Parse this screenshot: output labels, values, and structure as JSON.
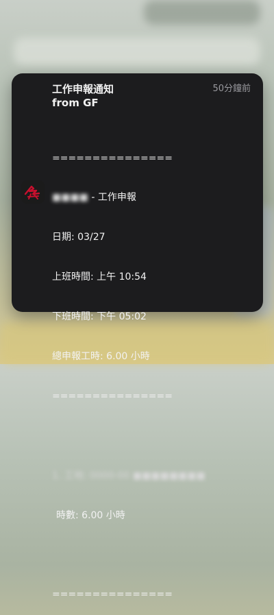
{
  "notification": {
    "title": "工作申報通知",
    "subtitle": "from GF",
    "time_ago": "50分鐘前",
    "app_icon": "calligraphy-app-icon",
    "lines": {
      "sep1": "===============",
      "report_name": "■■■■ - 工作申報",
      "date": "日期: 03/27",
      "clock_in": "上班時間: 上午 10:54",
      "clock_out": "下班時間: 下午 05:02",
      "total_hours": "總申報工時: 6.00 小時",
      "sep2": "===============",
      "blank": "",
      "item_line": "1. 工地: 0000-00 ■■■■■■■■",
      "item_hours": "時數: 6.00 小時",
      "blank2": "",
      "sep3": "==============="
    }
  },
  "colors": {
    "card_bg": "#1c1c1e",
    "text": "#f2f2f2",
    "secondary_text": "#9a9a9f",
    "icon_red": "#c8102e"
  }
}
